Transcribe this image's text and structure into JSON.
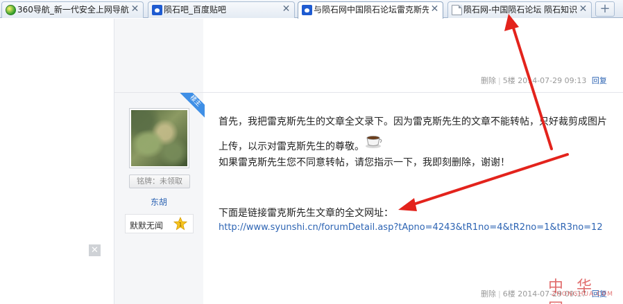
{
  "browser": {
    "tabs": [
      {
        "title": "360导航_新一代安全上网导航",
        "icon": "360-icon"
      },
      {
        "title": "陨石吧_百度贴吧",
        "icon": "baidu-paw-icon"
      },
      {
        "title": "与陨石网中国陨石论坛雷克斯先",
        "icon": "baidu-paw-icon"
      },
      {
        "title": "陨石网-中国陨石论坛 陨石知识",
        "icon": "page-icon"
      }
    ],
    "new_tab": "+",
    "close_glyph": "✕"
  },
  "post_prev": {
    "delete": "删除",
    "floor": "5楼",
    "time": "2014-07-29 09:13",
    "reply": "回复"
  },
  "post": {
    "corner_label": "楼主",
    "badge": "铭牌：未领取",
    "username": "东胡",
    "level_title": "默默无闻",
    "level_num": "1",
    "lines": [
      "首先，我把雷克斯先生的文章全文录下。因为雷克斯先生的文章不能转帖，只好裁剪成图片",
      "上传，以示对雷克斯先生的尊敬。",
      "如果雷克斯先生您不同意转帖，请您指示一下，我即刻删除，谢谢！",
      "下面是链接雷克斯先生文章的全文网址："
    ],
    "link": "http://www.syunshi.cn/forumDetail.asp?tApno=4243&tR1no=4&tR2no=1&tR3no=12"
  },
  "post_next": {
    "delete": "删除",
    "floor": "6楼",
    "time": "2014-07-29 09:17",
    "reply": "回复"
  },
  "watermark": {
    "text": "中 华 网",
    "sub": "ZHONGHUA.COM"
  },
  "colors": {
    "link": "#2d64b3",
    "arrow": "#e3231c",
    "ribbon": "#3f8fe6"
  }
}
